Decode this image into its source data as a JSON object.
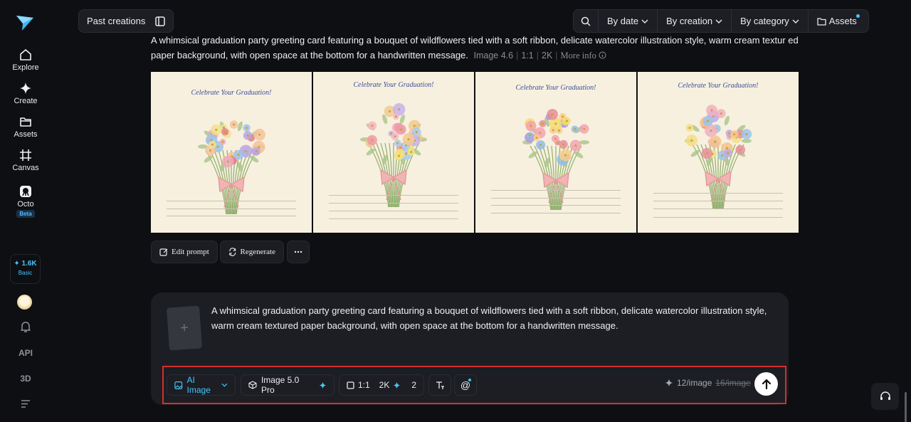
{
  "sidebar": {
    "nav": [
      {
        "label": "Explore",
        "icon": "home-icon"
      },
      {
        "label": "Create",
        "icon": "sparkle-icon"
      },
      {
        "label": "Assets",
        "icon": "folder-icon"
      },
      {
        "label": "Canvas",
        "icon": "canvas-icon"
      },
      {
        "label": "Octo",
        "icon": "octo-icon",
        "badge": "Beta"
      }
    ],
    "credits": {
      "value": "✦ 1.6K",
      "plan": "Basic"
    },
    "api_label": "API",
    "three_d_label": "3D"
  },
  "topbar": {
    "past_creations": "Past creations",
    "filters": [
      "By date",
      "By creation",
      "By category"
    ],
    "assets": "Assets"
  },
  "result": {
    "prompt": "A whimsical graduation party greeting card featuring a bouquet of wildflowers tied with a soft ribbon, delicate watercolor illustration style, warm cream textur ed paper background, with open space at the bottom for a handwritten message.",
    "model": "Image 4.6",
    "ratio": "1:1",
    "resolution": "2K",
    "more_info": "More info",
    "card_title": "Celebrate Your Graduation!",
    "actions": {
      "edit": "Edit prompt",
      "regenerate": "Regenerate"
    }
  },
  "composer": {
    "prompt": "A whimsical graduation party greeting card featuring a bouquet of wildflowers tied with a soft ribbon, delicate watercolor illustration style, warm cream textured paper background, with open space at the bottom for a handwritten message.",
    "mode": "AI Image",
    "model": "Image 5.0 Pro",
    "ratio": "1:1",
    "resolution": "2K",
    "count": "2",
    "cost": "12/image",
    "old_cost": "16/image"
  },
  "colors": {
    "accent": "#45c6ff",
    "highlight": "#d32f2f",
    "card": "#f7f0df"
  }
}
